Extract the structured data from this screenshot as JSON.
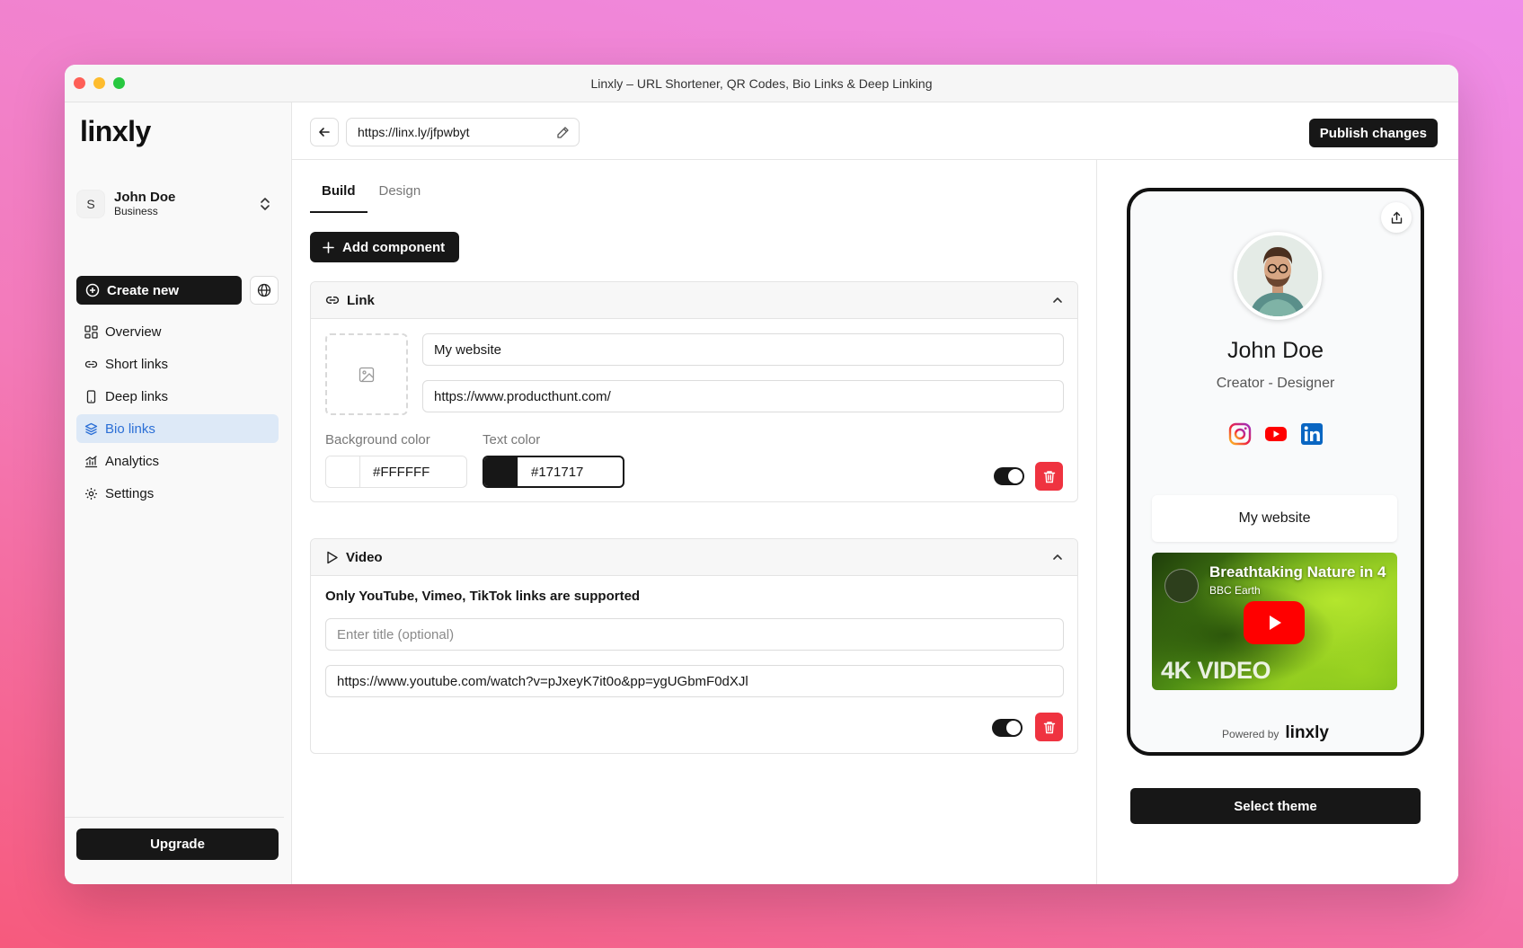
{
  "window": {
    "title": "Linxly – URL Shortener, QR Codes, Bio Links & Deep Linking"
  },
  "sidebar": {
    "logo": "linxly",
    "account": {
      "initial": "S",
      "name": "John Doe",
      "plan": "Business"
    },
    "create_label": "Create new",
    "items": [
      {
        "label": "Overview",
        "icon": "grid-icon"
      },
      {
        "label": "Short links",
        "icon": "link-icon"
      },
      {
        "label": "Deep links",
        "icon": "phone-icon"
      },
      {
        "label": "Bio links",
        "icon": "layers-icon",
        "active": true
      },
      {
        "label": "Analytics",
        "icon": "chart-icon"
      },
      {
        "label": "Settings",
        "icon": "gear-icon"
      }
    ],
    "upgrade_label": "Upgrade"
  },
  "topbar": {
    "url": "https://linx.ly/jfpwbyt",
    "publish_label": "Publish changes"
  },
  "editor": {
    "tabs": [
      {
        "label": "Build",
        "active": true
      },
      {
        "label": "Design",
        "active": false
      }
    ],
    "add_component_label": "Add component",
    "link_card": {
      "title": "Link",
      "title_value": "My website",
      "url_value": "https://www.producthunt.com/",
      "bg_color_label": "Background color",
      "bg_color": "#FFFFFF",
      "text_color_label": "Text color",
      "text_color": "#171717",
      "enabled": true
    },
    "video_card": {
      "title": "Video",
      "note": "Only YouTube, Vimeo, TikTok links are supported",
      "title_placeholder": "Enter title (optional)",
      "url_value": "https://www.youtube.com/watch?v=pJxeyK7it0o&pp=ygUGbmF0dXJl",
      "enabled": true
    }
  },
  "preview": {
    "name": "John Doe",
    "role": "Creator - Designer",
    "socials": [
      "instagram-icon",
      "youtube-icon",
      "linkedin-icon"
    ],
    "link_button": "My website",
    "video": {
      "title": "Breathtaking Nature in 4",
      "channel": "BBC Earth",
      "overlay": "4K VIDEO"
    },
    "powered_by": "Powered by",
    "powered_brand": "linxly",
    "select_theme_label": "Select theme"
  },
  "colors": {
    "accent": "#171717",
    "danger": "#ef3340",
    "active_nav_bg": "#dde9f7",
    "active_nav_text": "#2b6fd6"
  }
}
